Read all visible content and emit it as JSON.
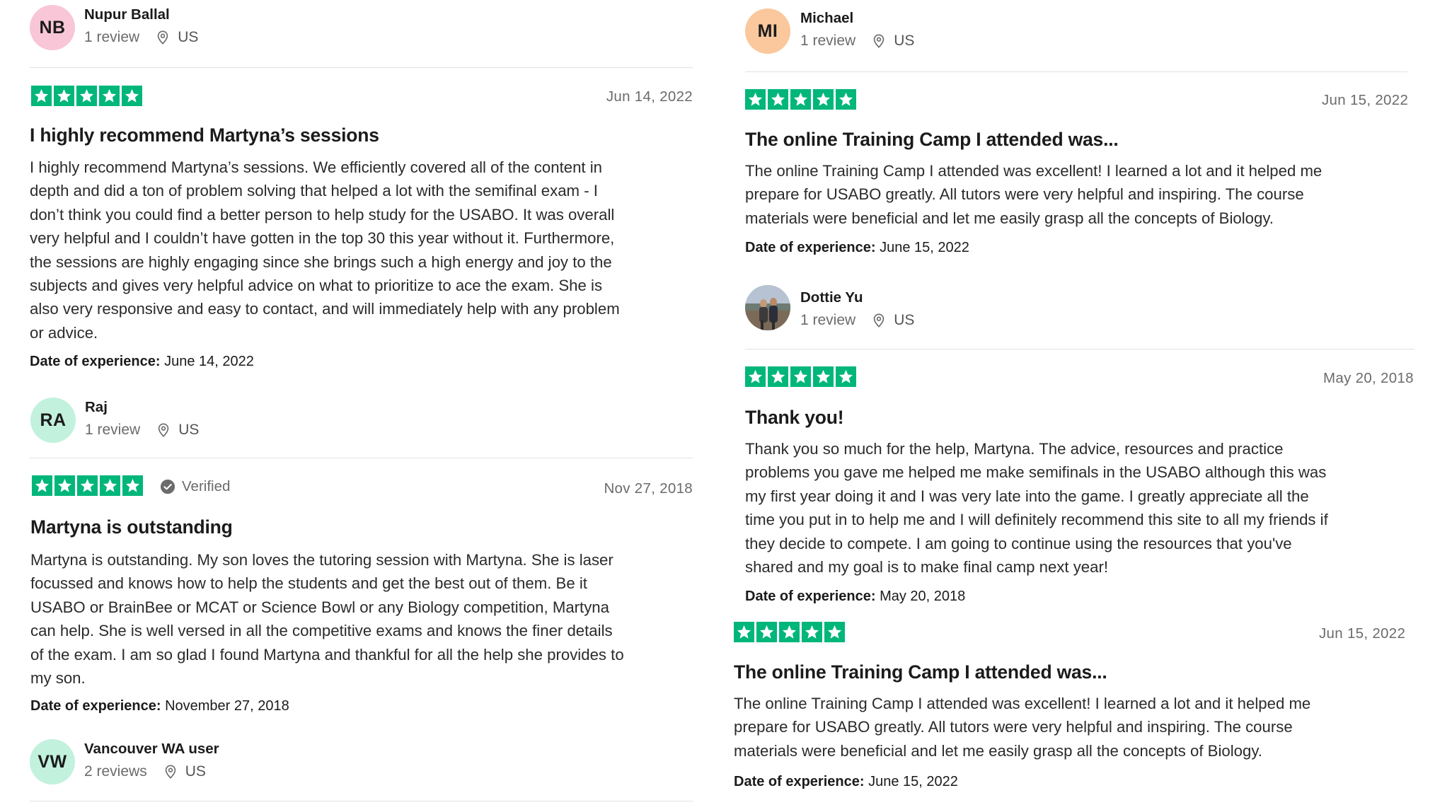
{
  "icons": {
    "star": "star-icon",
    "location": "location-pin-icon",
    "verified": "verified-check-icon"
  },
  "colors": {
    "star_bg": "#00b67a",
    "avatar_pink": "#f8c6d6",
    "avatar_orange": "#fac89c",
    "avatar_green": "#c2f1de"
  },
  "date_of_experience_label": "Date of experience:",
  "reviews": [
    {
      "reviewer": {
        "initials": "NB",
        "name": "Nupur Ballal",
        "review_count": "1 review",
        "country": "US"
      },
      "rating": 5,
      "date": "Jun 14, 2022",
      "title": "I highly recommend Martyna’s sessions",
      "lines": [
        "I highly recommend Martyna’s sessions. We efficiently covered all of the content in",
        "depth and did a ton of problem solving that helped a lot with the semifinal exam - I",
        "don’t think you could find a better person to help study for the USABO. It was overall",
        "very helpful and I couldn’t have gotten in the top 30 this year without it. Furthermore,",
        "the sessions are highly engaging since she brings such a high energy and joy to the",
        "subjects and gives very helpful advice on what to prioritize to ace the exam. She is",
        "also very responsive and easy to contact, and will immediately help with any problem",
        "or advice."
      ],
      "experience_date": "June 14, 2022"
    },
    {
      "reviewer": {
        "initials": "RA",
        "name": "Raj",
        "review_count": "1 review",
        "country": "US"
      },
      "rating": 5,
      "verified": "Verified",
      "date": "Nov 27, 2018",
      "title": "Martyna is outstanding",
      "lines": [
        "Martyna is outstanding. My son loves the tutoring session with Martyna. She is laser",
        "focussed and knows how to help the students and get the best out of them. Be it",
        "USABO or BrainBee or MCAT or Science Bowl or any Biology competition, Martyna",
        "can help. She is well versed in all the competitive exams and knows the finer details",
        "of the exam. I am so glad I found Martyna and thankful for all the help she provides to",
        "my son."
      ],
      "experience_date": "November 27, 2018"
    },
    {
      "reviewer": {
        "initials": "VW",
        "name": "Vancouver WA user",
        "review_count": "2 reviews",
        "country": "US"
      }
    },
    {
      "reviewer": {
        "initials": "MI",
        "name": "Michael",
        "review_count": "1 review",
        "country": "US"
      },
      "rating": 5,
      "date": "Jun 15, 2022",
      "title": "The online Training Camp I attended was...",
      "lines": [
        "The online Training Camp I attended was excellent! I learned a lot and it helped me",
        "prepare for USABO greatly. All tutors were very helpful and inspiring. The course",
        "materials were beneficial and let me easily grasp all the concepts of Biology."
      ],
      "experience_date": "June 15, 2022"
    },
    {
      "reviewer": {
        "name": "Dottie Yu",
        "review_count": "1 review",
        "country": "US"
      },
      "rating": 5,
      "date": "May 20, 2018",
      "title": "Thank you!",
      "lines": [
        "Thank you so much for the help, Martyna. The advice, resources and practice",
        "problems you gave me helped me make semifinals in the USABO although this was",
        "my first year doing it and I was very late into the game. I greatly appreciate all the",
        "time you put in to help me and I will definitely recommend this site to all my friends if",
        "they decide to compete. I am going to continue using the resources that you've",
        "shared and my goal is to make final camp next year!"
      ],
      "experience_date": "May 20, 2018"
    },
    {
      "rating": 5,
      "date": "Jun 15, 2022",
      "title": "The online Training Camp I attended was...",
      "lines": [
        "The online Training Camp I attended was excellent! I learned a lot and it helped me",
        "prepare for USABO greatly. All tutors were very helpful and inspiring. The course",
        "materials were beneficial and let me easily grasp all the concepts of Biology."
      ],
      "experience_date": "June 15, 2022"
    }
  ]
}
